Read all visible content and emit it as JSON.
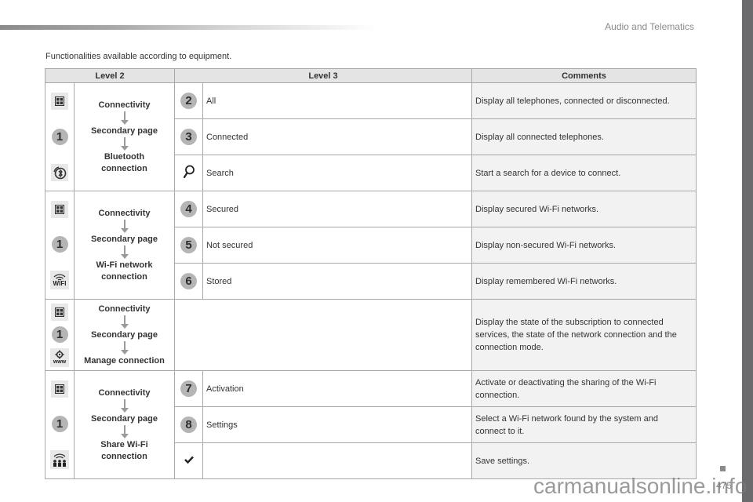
{
  "header": {
    "section_title": "Audio and Telematics"
  },
  "intro_text": "Functionalities available according to equipment.",
  "table": {
    "columns": [
      "Level 2",
      "Level 3",
      "Comments"
    ],
    "groups": [
      {
        "level1_icon": "connectivity-grid-icon",
        "level1_badge": "1",
        "level2_icon": "bluetooth-icon",
        "level2_path": [
          "Connectivity",
          "Secondary page",
          "Bluetooth connection"
        ],
        "rows": [
          {
            "marker": "2",
            "marker_type": "badge",
            "level3": "All",
            "comment": "Display all telephones, connected or disconnected."
          },
          {
            "marker": "3",
            "marker_type": "badge",
            "level3": "Connected",
            "comment": "Display all connected telephones."
          },
          {
            "marker": "search-icon",
            "marker_type": "icon",
            "level3": "Search",
            "comment": "Start a search for a device to connect."
          }
        ]
      },
      {
        "level1_icon": "connectivity-grid-icon",
        "level1_badge": "1",
        "level2_icon": "wifi-icon",
        "level2_icon_label": "WIFI",
        "level2_path": [
          "Connectivity",
          "Secondary page",
          "Wi-Fi network connection"
        ],
        "rows": [
          {
            "marker": "4",
            "marker_type": "badge",
            "level3": "Secured",
            "comment": "Display secured Wi-Fi networks."
          },
          {
            "marker": "5",
            "marker_type": "badge",
            "level3": "Not secured",
            "comment": "Display non-secured Wi-Fi networks."
          },
          {
            "marker": "6",
            "marker_type": "badge",
            "level3": "Stored",
            "comment": "Display remembered Wi-Fi networks."
          }
        ]
      },
      {
        "level1_icon": "connectivity-grid-icon",
        "level1_badge": "1",
        "level2_icon": "gear-www-icon",
        "level2_icon_label": "www",
        "level2_path": [
          "Connectivity",
          "Secondary page",
          "Manage connection"
        ],
        "rows": [
          {
            "marker": "",
            "marker_type": "none",
            "level3": "",
            "comment": "Display the state of the subscription to connected services, the state of the network connection and the connection mode."
          }
        ]
      },
      {
        "level1_icon": "connectivity-grid-icon",
        "level1_badge": "1",
        "level2_icon": "share-wifi-icon",
        "level2_path": [
          "Connectivity",
          "Secondary page",
          "Share Wi-Fi connection"
        ],
        "rows": [
          {
            "marker": "7",
            "marker_type": "badge",
            "level3": "Activation",
            "comment": "Activate or deactivating the sharing of the Wi-Fi connection."
          },
          {
            "marker": "8",
            "marker_type": "badge",
            "level3": "Settings",
            "comment": "Select a Wi-Fi network found by the system and connect to it."
          },
          {
            "marker": "checkmark-icon",
            "marker_type": "icon",
            "level3": "",
            "comment": "Save settings."
          }
        ]
      }
    ]
  },
  "footer": {
    "page_number": "475",
    "watermark": "carmanualsonline.info"
  },
  "colors": {
    "header_bg": "#e4e4e5",
    "comment_bg": "#f2f2f2",
    "badge_bg": "#b5b5b6",
    "border": "#a8a8a8",
    "side_bar": "#6b6b6d"
  }
}
